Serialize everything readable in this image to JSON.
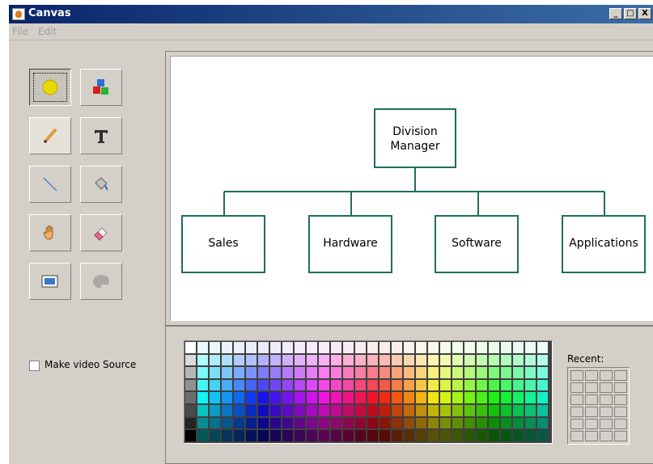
{
  "window": {
    "title": "Canvas",
    "controls": [
      "_",
      "□",
      "X"
    ]
  },
  "menu": {
    "items": [
      "File",
      "Edit"
    ]
  },
  "tools": [
    {
      "name": "ellipse-tool",
      "icon": "yellow-circle-icon"
    },
    {
      "name": "shapes-tool",
      "icon": "colored-blocks-icon"
    },
    {
      "name": "pencil-tool",
      "icon": "pencil-icon"
    },
    {
      "name": "text-tool",
      "icon": "text-t-icon"
    },
    {
      "name": "line-tool",
      "icon": "line-icon"
    },
    {
      "name": "fill-tool",
      "icon": "paint-bucket-icon"
    },
    {
      "name": "pan-tool",
      "icon": "hand-icon"
    },
    {
      "name": "eraser-tool",
      "icon": "eraser-icon"
    },
    {
      "name": "image-tool",
      "icon": "picture-icon"
    },
    {
      "name": "palette-tool",
      "icon": "palette-icon"
    }
  ],
  "video_source": {
    "label": "Make video Source",
    "checked": false
  },
  "org_chart": {
    "root": [
      "Division",
      "Manager"
    ],
    "children": [
      "Sales",
      "Hardware",
      "Software",
      "Applications"
    ],
    "line_color": "#1e6f5c"
  },
  "palette": {
    "recent_label": "Recent:",
    "columns": 30,
    "rows": 8,
    "recent_rows": 6,
    "recent_columns": 4
  }
}
